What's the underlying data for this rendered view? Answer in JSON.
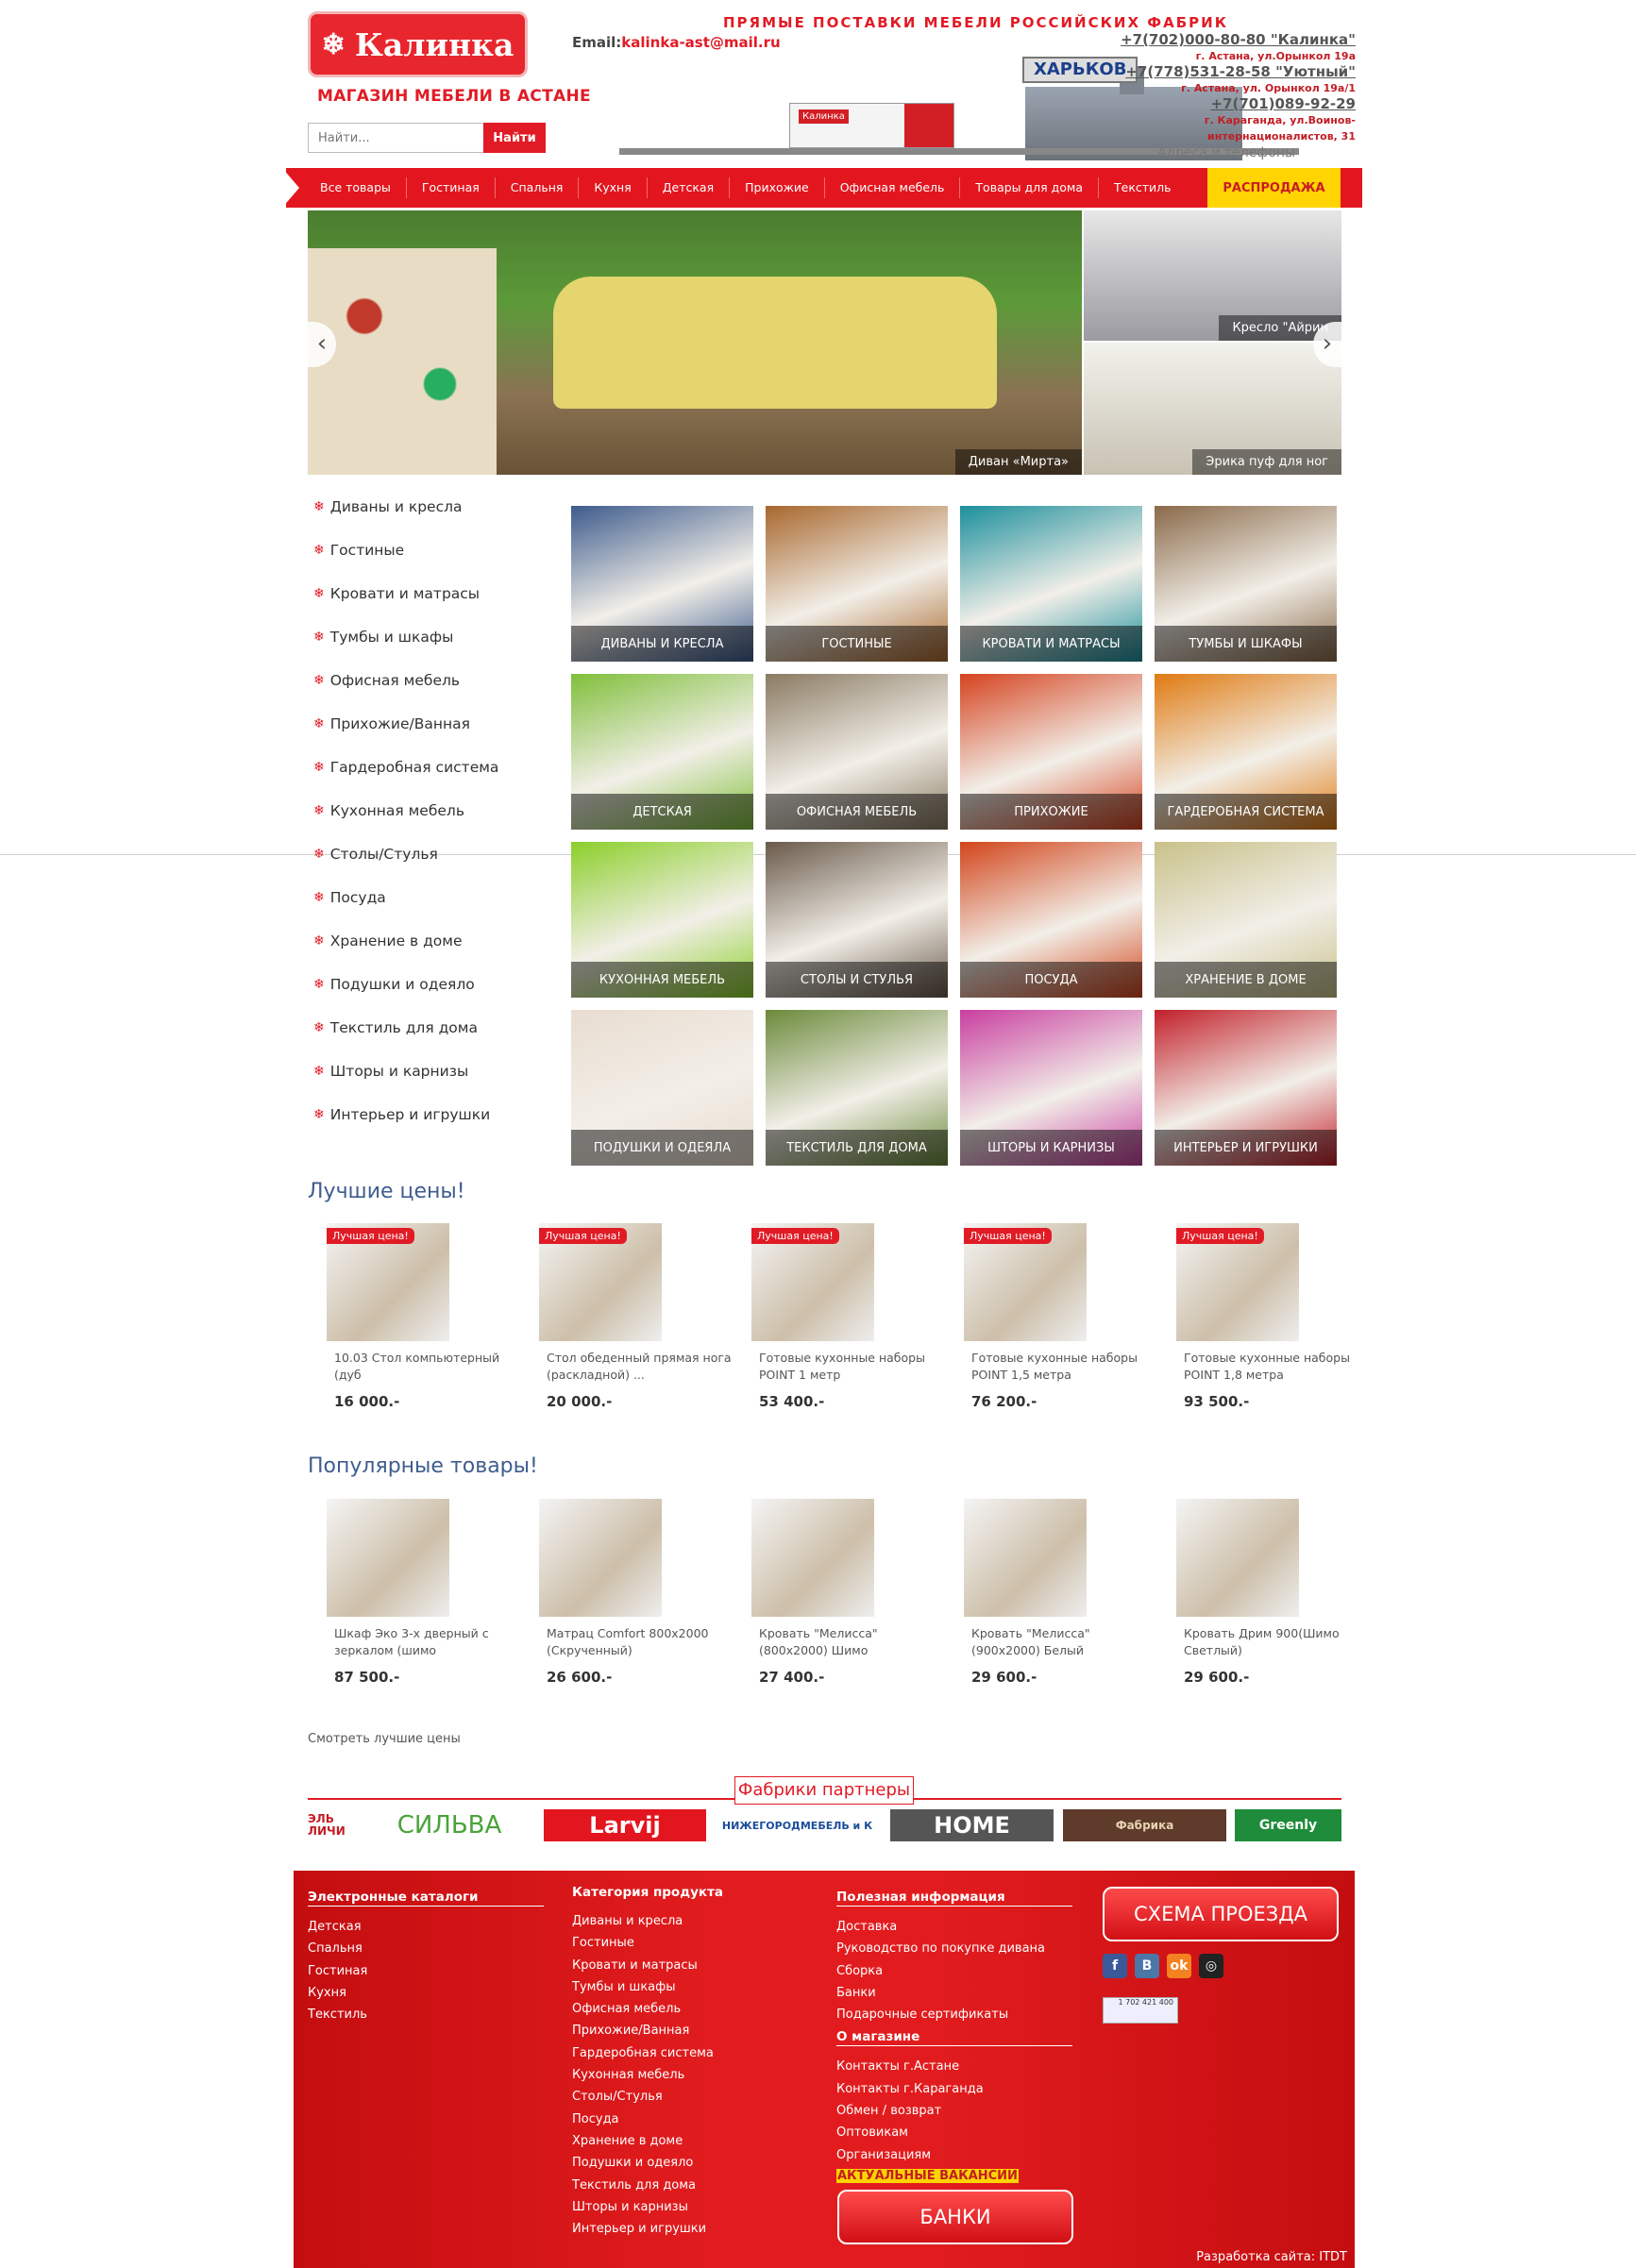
{
  "header": {
    "logo_text": "Калинка",
    "logo_subtitle": "МАГАЗИН МЕБЕЛИ В АСТАНЕ",
    "email_label": "Email:",
    "email": "kalinka-ast@mail.ru",
    "slogan": "ПРЯМЫЕ ПОСТАВКИ МЕБЕЛИ РОССИЙСКИХ ФАБРИК",
    "city": "ХАРЬКОВ",
    "truck_label": "Калинка",
    "addresses_link": "Адреса и телефоны",
    "search_placeholder": "Найти...",
    "search_button": "Найти",
    "contacts": [
      {
        "phone": "+7(702)000-80-80 \"Калинка\"",
        "address": "г. Астана, ул.Орынкол 19а"
      },
      {
        "phone": "+7(778)531-28-58 \"Уютный\"",
        "address": "г. Астана, ул. Орынкол 19а/1"
      },
      {
        "phone": "+7(701)089-92-29",
        "address": "г. Караганда, ул.Воинов-интернационалистов, 31"
      }
    ]
  },
  "nav": {
    "items": [
      "Все товары",
      "Гостиная",
      "Спальня",
      "Кухня",
      "Детская",
      "Прихожие",
      "Офисная мебель",
      "Товары для дома",
      "Текстиль"
    ],
    "sale": "РАСПРОДАЖА"
  },
  "slider": {
    "main_caption": "Диван «Мирта»",
    "right_top_caption": "Кресло \"Айрин",
    "right_bottom_caption": "Эрика пуф для ног",
    "prev_icon": "‹",
    "next_icon": "›"
  },
  "sidebar": {
    "items": [
      "Диваны и кресла",
      "Гостиные",
      "Кровати и матрасы",
      "Тумбы и шкафы",
      "Офисная мебель",
      "Прихожие/Ванная",
      "Гардеробная система",
      "Кухонная мебель",
      "Столы/Стулья",
      "Посуда",
      "Хранение в доме",
      "Подушки и одеяло",
      "Текстиль для дома",
      "Шторы и карнизы",
      "Интерьер и игрушки"
    ]
  },
  "categories": [
    {
      "label": "ДИВАНЫ И КРЕСЛА",
      "color": "#3d5b8c"
    },
    {
      "label": "ГОСТИНЫЕ",
      "color": "#a8672d"
    },
    {
      "label": "КРОВАТИ И МАТРАСЫ",
      "color": "#1c8f9c"
    },
    {
      "label": "ТУМБЫ И ШКАФЫ",
      "color": "#8a6a4a"
    },
    {
      "label": "ДЕТСКАЯ",
      "color": "#7fbf3a"
    },
    {
      "label": "ОФИСНАЯ МЕБЕЛЬ",
      "color": "#8a7a62"
    },
    {
      "label": "ПРИХОЖИЕ",
      "color": "#d5431f"
    },
    {
      "label": "ГАРДЕРОБНАЯ СИСТЕМА",
      "color": "#e07a12"
    },
    {
      "label": "КУХОННАЯ МЕБЕЛЬ",
      "color": "#8bcf2a"
    },
    {
      "label": "СТОЛЫ И СТУЛЬЯ",
      "color": "#6a5a4a"
    },
    {
      "label": "ПОСУДА",
      "color": "#d2451b"
    },
    {
      "label": "ХРАНЕНИЕ В ДОМЕ",
      "color": "#c9c18a"
    },
    {
      "label": "ПОДУШКИ И ОДЕЯЛА",
      "color": "#e9dcd0"
    },
    {
      "label": "ТЕКСТИЛЬ ДЛЯ ДОМА",
      "color": "#6b8a3a"
    },
    {
      "label": "ШТОРЫ И КАРНИЗЫ",
      "color": "#c93fa0"
    },
    {
      "label": "ИНТЕРЬЕР И ИГРУШКИ",
      "color": "#c2202a"
    }
  ],
  "best_prices": {
    "title": "Лучшие цены!",
    "badge": "Лучшая цена!",
    "items": [
      {
        "name": "10.03 Стол компьютерный (дуб",
        "price": "16 000.-"
      },
      {
        "name": "Стол обеденный прямая нога (раскладной) ...",
        "price": "20 000.-"
      },
      {
        "name": "Готовые кухонные наборы POINT 1 метр",
        "price": "53 400.-"
      },
      {
        "name": "Готовые кухонные наборы POINT 1,5 метра",
        "price": "76 200.-"
      },
      {
        "name": "Готовые кухонные наборы POINT 1,8 метра",
        "price": "93 500.-"
      }
    ]
  },
  "popular": {
    "title": "Популярные товары!",
    "items": [
      {
        "name": "Шкаф Эко 3-х дверный с зеркалом (шимо",
        "price": "87 500.-"
      },
      {
        "name": "Матрац Comfort 800х2000 (Скрученный)",
        "price": "26 600.-"
      },
      {
        "name": "Кровать \"Мелисса\" (800х2000) Шимо",
        "price": "27 400.-"
      },
      {
        "name": "Кровать \"Мелисса\" (900х2000) Белый",
        "price": "29 600.-"
      },
      {
        "name": "Кровать Дрим 900(Шимо Светлый)",
        "price": "29 600.-"
      }
    ]
  },
  "see_best": "Смотреть лучшие цены",
  "partners": {
    "title": "Фабрики партнеры",
    "logos": [
      "ЭЛЬ ЛИЧИ",
      "СИЛЬВА",
      "Larvij",
      "НИЖЕГОРОДМЕБЕЛЬ и К",
      "HOME",
      "Фабрика",
      "Greenly"
    ]
  },
  "footer": {
    "catalogs": {
      "title": "Электронные каталоги",
      "items": [
        "Детская",
        "Спальня",
        "Гостиная",
        "Кухня",
        "Текстиль"
      ]
    },
    "categories": {
      "title": "Категория продукта",
      "items": [
        "Диваны и кресла",
        "Гостиные",
        "Кровати и матрасы",
        "Тумбы и шкафы",
        "Офисная мебель",
        "Прихожие/Ванная",
        "Гардеробная система",
        "Кухонная мебель",
        "Столы/Стулья",
        "Посуда",
        "Хранение в доме",
        "Подушки и одеяло",
        "Текстиль для дома",
        "Шторы и карнизы",
        "Интерьер и игрушки"
      ]
    },
    "useful": {
      "title": "Полезная информация",
      "items": [
        "Доставка",
        "Руководство по покупке дивана",
        "Сборка",
        "Банки",
        "Подарочные сертификаты"
      ]
    },
    "about": {
      "title": "О магазине",
      "items": [
        "Контакты г.Астане",
        "Контакты г.Караганда",
        "Обмен / возврат",
        "Оптовикам",
        "Организациям"
      ],
      "highlight": "АКТУАЛЬНЫЕ ВАКАНСИИ"
    },
    "banks_button": "БАНКИ",
    "map_button": "СХЕМА ПРОЕЗДА",
    "counter": "1 702 421 400",
    "developer": "Разработка сайта: ITDT"
  }
}
